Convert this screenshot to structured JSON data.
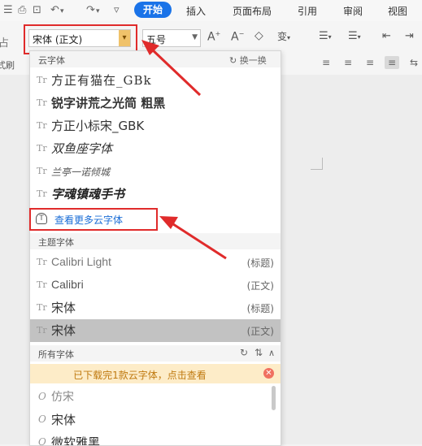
{
  "menubar": {
    "tabs": [
      "开始",
      "插入",
      "页面布局",
      "引用",
      "审阅",
      "视图"
    ],
    "quick_access": [
      "⎙",
      "🔍",
      "↶",
      "↷",
      "▿"
    ]
  },
  "ribbon": {
    "font_value": "宋体 (正文)",
    "size_value": "五号",
    "left_fragment_top": "占",
    "left_fragment_bottom": "式刷",
    "font_tools": [
      "A⁺",
      "A⁻",
      "◇",
      "变"
    ],
    "para_tools": [
      "☰▾",
      "☰▾",
      "⇤",
      "⇥"
    ],
    "align_tools": [
      "≡",
      "≡",
      "≡",
      "≡",
      "⇆"
    ]
  },
  "dropdown": {
    "cloud_section": {
      "title": "云字体",
      "action": "换一换"
    },
    "cloud_fonts": [
      "方正有猫在_GBk",
      "锐字讲荒之光简 粗黑",
      "方正小标宋_GBK",
      "双鱼座字体",
      "兰亭一诺倾城",
      "字魂镇魂手书"
    ],
    "more_cloud": "查看更多云字体",
    "theme_section": {
      "title": "主题字体"
    },
    "theme_fonts": [
      {
        "name": "Calibri Light",
        "tag": "(标题)"
      },
      {
        "name": "Calibri",
        "tag": "(正文)"
      },
      {
        "name": "宋体",
        "tag": "(标题)"
      },
      {
        "name": "宋体",
        "tag": "(正文)"
      }
    ],
    "all_section": {
      "title": "所有字体"
    },
    "notice": "已下载完1款云字体，点击查看",
    "all_fonts": [
      "仿宋",
      "宋体",
      "微软雅黑"
    ]
  },
  "colors": {
    "accent": "#1a73e8",
    "highlight_red": "#e02b2b",
    "notice_bg": "#fdecc8",
    "selected_row": "#c2c2c2"
  }
}
